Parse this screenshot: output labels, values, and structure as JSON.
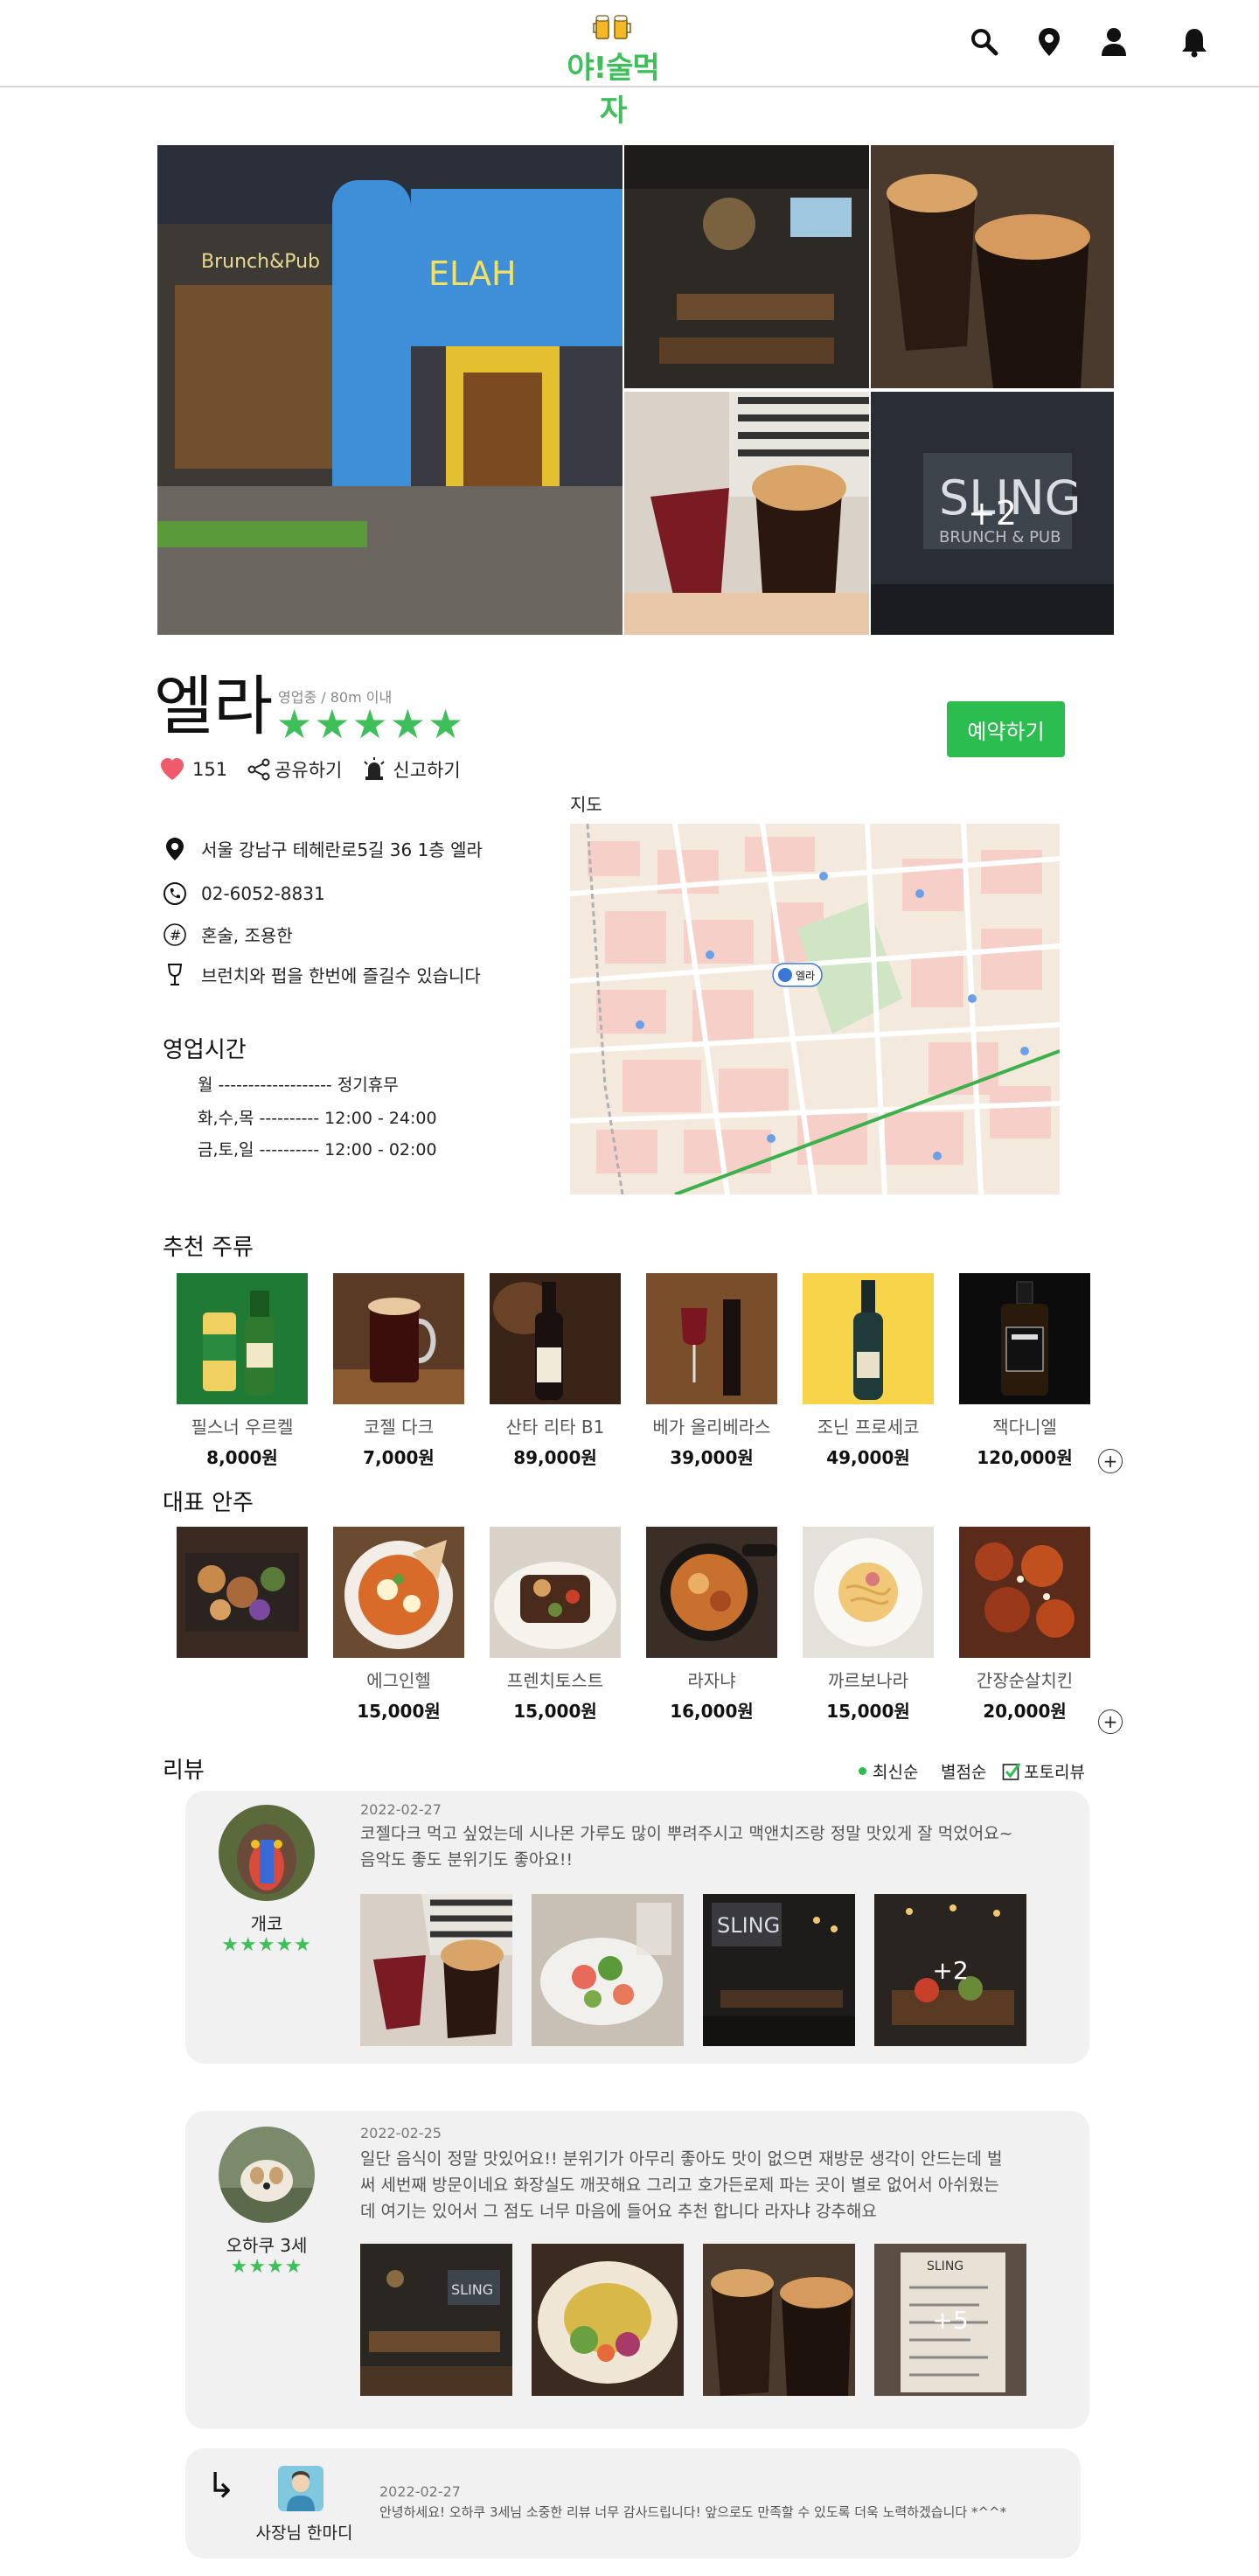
{
  "header": {
    "logo_text": "야!술먹자",
    "icons": [
      "search-icon",
      "location-pin-icon",
      "user-icon",
      "bell-icon"
    ]
  },
  "gallery": {
    "more_count": "+2"
  },
  "place": {
    "name": "엘라",
    "status": "영업중 / 80m 이내",
    "rating_stars": "★★★★★",
    "likes": "151",
    "share_label": "공유하기",
    "report_label": "신고하기",
    "reserve_label": "예약하기",
    "address": "서울 강남구 테헤란로5길 36 1층 엘라",
    "phone": "02-6052-8831",
    "tags": "혼술, 조용한",
    "description": "브런치와 펍을 한번에 즐길수 있습니다"
  },
  "map": {
    "title": "지도",
    "marker_label": "엘라"
  },
  "hours": {
    "title": "영업시간",
    "rows": [
      "월 ------------------- 정기휴무",
      "화,수,목 ---------- 12:00 - 24:00",
      "금,토,일 ---------- 12:00 - 02:00"
    ]
  },
  "drinks": {
    "title": "추천 주류",
    "items": [
      {
        "name": "필스너 우르켈",
        "price": "8,000원"
      },
      {
        "name": "코젤 다크",
        "price": "7,000원"
      },
      {
        "name": "산타 리타 B1",
        "price": "89,000원"
      },
      {
        "name": "베가 올리베라스",
        "price": "39,000원"
      },
      {
        "name": "조닌 프로세코",
        "price": "49,000원"
      },
      {
        "name": "잭다니엘",
        "price": "120,000원"
      }
    ],
    "more": "+"
  },
  "dishes": {
    "title": "대표 안주",
    "items": [
      {
        "name": "",
        "price": ""
      },
      {
        "name": "에그인헬",
        "price": "15,000원"
      },
      {
        "name": "프렌치토스트",
        "price": "15,000원"
      },
      {
        "name": "라자냐",
        "price": "16,000원"
      },
      {
        "name": "까르보나라",
        "price": "15,000원"
      },
      {
        "name": "간장순살치킨",
        "price": "20,000원"
      }
    ],
    "more": "+"
  },
  "reviews": {
    "title": "리뷰",
    "sort": {
      "latest": "최신순",
      "rating": "별점순",
      "photo": "포토리뷰"
    },
    "list": [
      {
        "name": "개코",
        "stars": "★★★★★",
        "date": "2022-02-27",
        "text_lines": [
          "코젤다크 먹고 싶었는데 시나몬 가루도 많이 뿌려주시고 맥앤치즈랑 정말 맛있게 잘 먹었어요~",
          "음악도 좋도 분위기도 좋아요!!"
        ],
        "more_count": "+2"
      },
      {
        "name": "오하쿠 3세",
        "stars": "★★★★",
        "date": "2022-02-25",
        "text_lines": [
          "일단 음식이 정말 맛있어요!! 분위기가 아무리 좋아도 맛이 없으면 재방문 생각이 안드는데 벌",
          "써 세번째 방문이네요 화장실도 깨끗해요 그리고 호가든로제 파는 곳이 별로 없어서 아쉬웠는",
          "데 여기는 있어서 그 점도 너무 마음에 들어요 추천 합니다 라자냐 강추해요"
        ],
        "more_count": "+5"
      }
    ],
    "reply": {
      "arrow": "↳",
      "name": "사장님 한마디",
      "date": "2022-02-27",
      "text": "안녕하세요! 오하쿠 3세님 소중한 리뷰 너무 감사드립니다! 앞으로도 만족할 수 있도록 더욱 노력하겠습니다 *^^*"
    }
  },
  "colors": {
    "accent": "#2bbd4f",
    "star": "#3fbf5a",
    "card_bg": "#f1f1f1"
  }
}
